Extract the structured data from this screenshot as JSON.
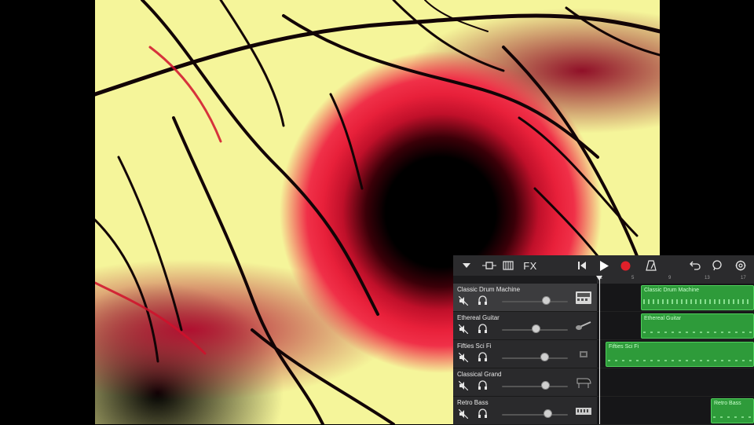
{
  "video": {},
  "toolbar": {
    "fx_label": "FX"
  },
  "ruler": {
    "ticks": [
      "1",
      "5",
      "9",
      "13",
      "17"
    ]
  },
  "tracks": [
    {
      "name": "Classic Drum Machine",
      "region_label": "Classic Drum Machine",
      "volume": 0.68,
      "selected": true
    },
    {
      "name": "Ethereal Guitar",
      "region_label": "Ethereal Guitar",
      "volume": 0.53,
      "selected": false
    },
    {
      "name": "Fifties Sci Fi",
      "region_label": "Fifties Sci Fi",
      "volume": 0.65,
      "selected": false
    },
    {
      "name": "Classical Grand",
      "region_label": "",
      "volume": 0.67,
      "selected": false
    },
    {
      "name": "Retro Bass",
      "region_label": "Retro Bass",
      "volume": 0.71,
      "selected": false
    }
  ],
  "colors": {
    "region_fill": "#2e9b3a",
    "record": "#e0202a",
    "panel_bg": "#1c1c1e"
  }
}
